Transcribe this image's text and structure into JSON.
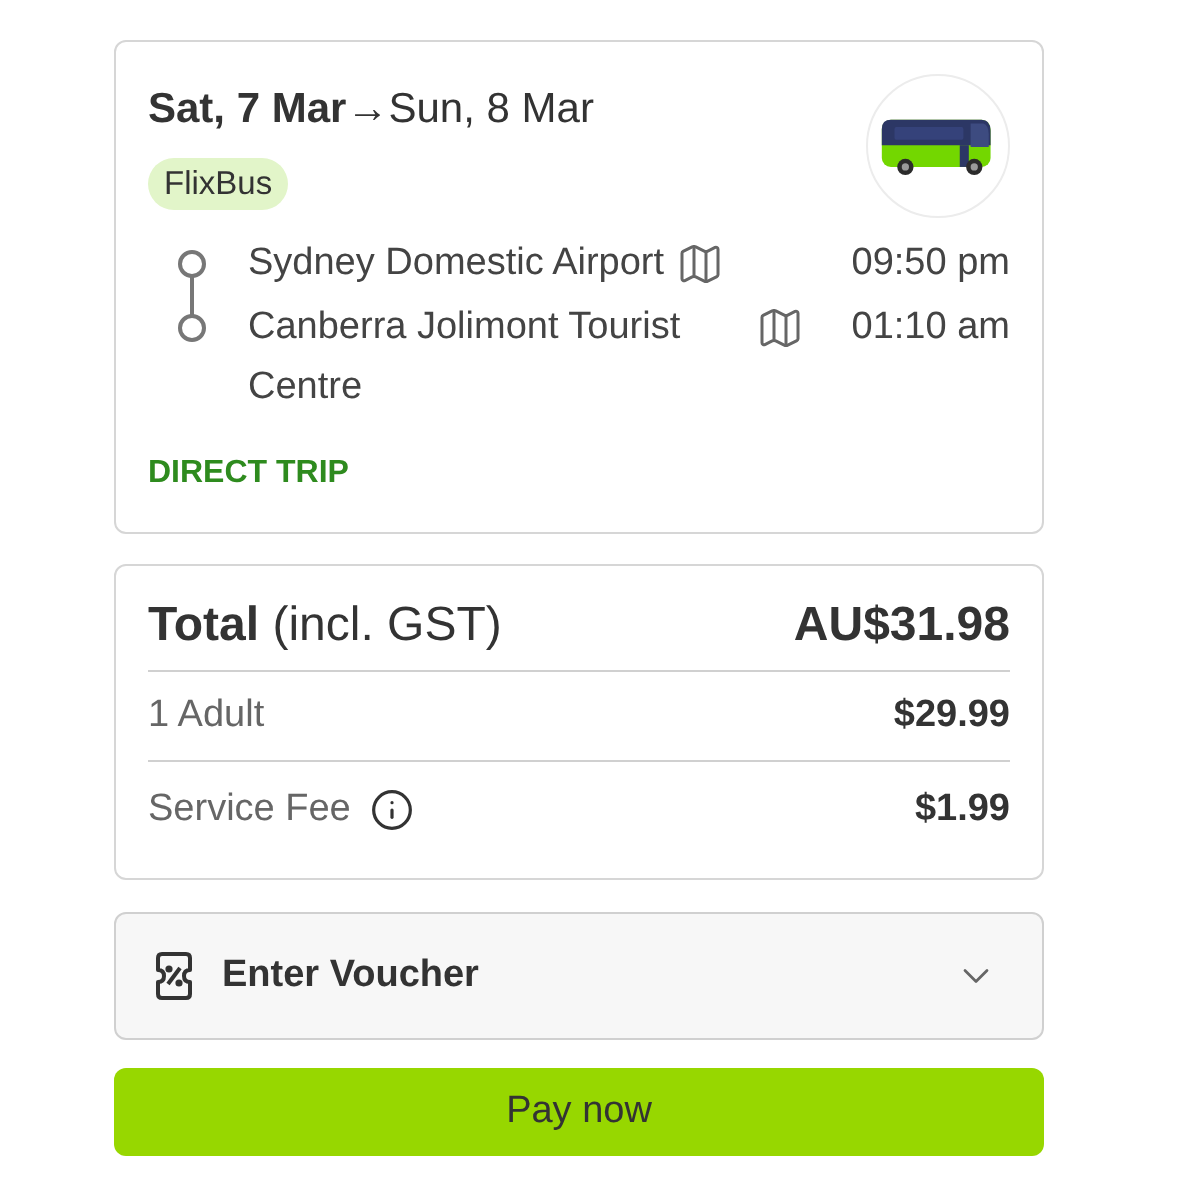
{
  "trip": {
    "date_range": "**Sat, 7 Mar**→Sun, 8 Mar",
    "operator": "FlixBus",
    "stops": [
      {
        "name": "Sydney Domestic Airport",
        "time": "09:50 pm"
      },
      {
        "name": "Canberra Jolimont Tourist Centre",
        "time": "01:10 am"
      }
    ],
    "trip_type": "DIRECT TRIP"
  },
  "price_summary": {
    "total_label": "**Total** (incl. GST)",
    "total": "AU$31.98",
    "lines": [
      {
        "label": "1 Adult",
        "amount": "$29.99",
        "has_info": false
      },
      {
        "label": "Service Fee",
        "amount": "$1.99",
        "has_info": true
      }
    ]
  },
  "voucher": {
    "label": "Enter Voucher",
    "expanded": false
  },
  "pay_button": {
    "label": "Pay now"
  }
}
